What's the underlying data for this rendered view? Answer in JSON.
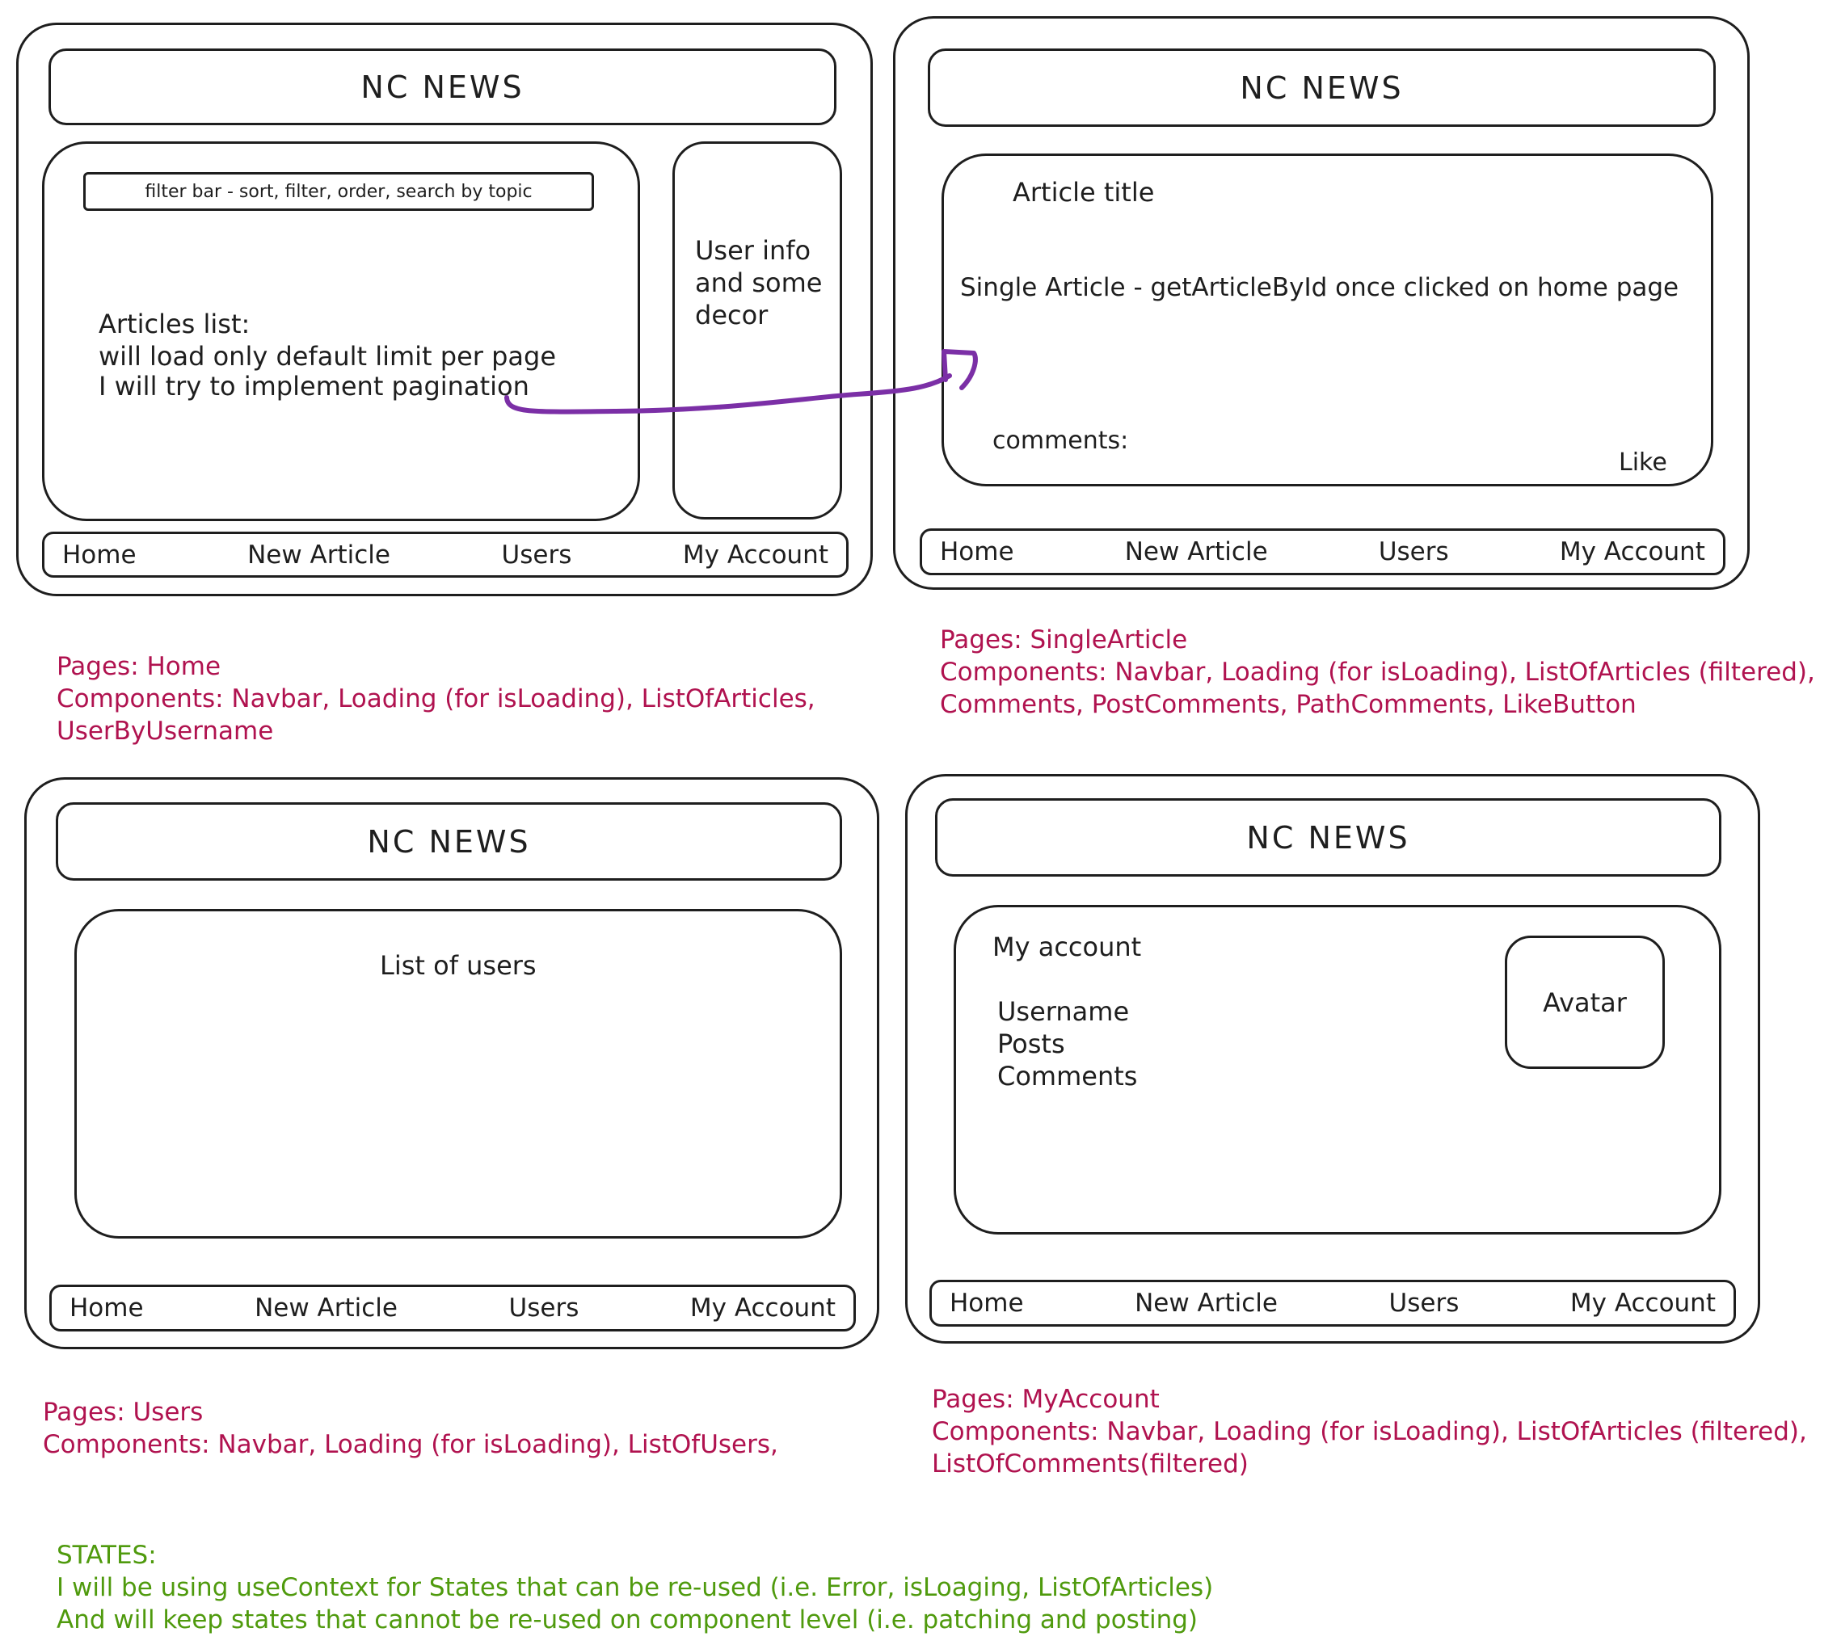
{
  "app_title": "NC NEWS",
  "navbar": [
    "Home",
    "New Article",
    "Users",
    "My Account"
  ],
  "home_page": {
    "filter_bar": "filter bar - sort, filter, order, search by topic",
    "articles_list": [
      "Articles list:",
      "will load only default limit per page",
      "I will try to implement pagination"
    ],
    "sidebar": [
      "User info",
      "and some",
      "decor"
    ],
    "note_pages": "Pages: Home",
    "note_components": [
      "Components: Navbar, Loading (for isLoading), ListOfArticles,",
      "UserByUsername"
    ]
  },
  "single_article_page": {
    "article_title": "Article title",
    "description": "Single Article - getArticleById once clicked on home page",
    "comments_label": "comments:",
    "like_label": "Like",
    "note_pages": "Pages: SingleArticle",
    "note_components": [
      "Components: Navbar, Loading (for isLoading), ListOfArticles (filtered),",
      "Comments, PostComments, PathComments, LikeButton"
    ]
  },
  "users_page": {
    "list_label": "List of users",
    "note_pages": "Pages: Users",
    "note_components": [
      "Components: Navbar, Loading (for isLoading), ListOfUsers,"
    ]
  },
  "my_account_page": {
    "heading": "My account",
    "fields": [
      "Username",
      "Posts",
      "Comments"
    ],
    "avatar_label": "Avatar",
    "note_pages": "Pages: MyAccount",
    "note_components": [
      "Components: Navbar, Loading (for isLoading), ListOfArticles (filtered),",
      "ListOfComments(filtered)"
    ]
  },
  "states_note": [
    "STATES:",
    "I will be using useContext for States that can be re-used (i.e. Error, isLoaging, ListOfArticles)",
    "And will keep states that cannot be re-used on component level (i.e. patching and posting)"
  ],
  "colors": {
    "stroke": "#1e1e1e",
    "note_pink": "#b0124f",
    "note_green": "#4f9a0d",
    "arrow_purple": "#7b2fa6"
  }
}
